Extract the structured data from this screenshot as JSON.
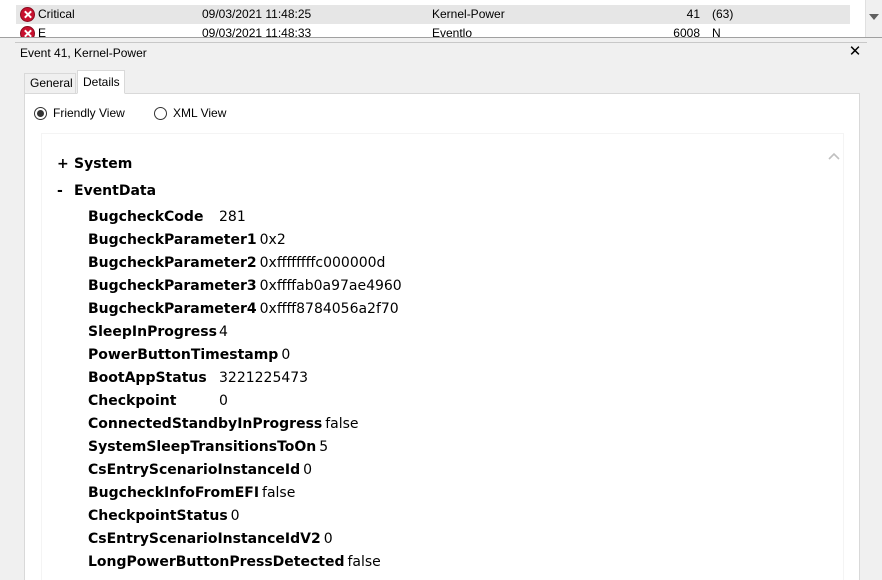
{
  "event_list": {
    "rows": [
      {
        "level": "Critical",
        "date": "09/03/2021 11:48:25",
        "source": "Kernel-Power",
        "event_id": "41",
        "task": "(63)",
        "selected": true
      },
      {
        "level": "E",
        "date": "09/03/2021 11:48:33",
        "source": "Eventlo",
        "event_id": "6008",
        "task": "N",
        "selected": false
      }
    ]
  },
  "detail": {
    "title": "Event 41, Kernel-Power",
    "close_glyph": "✕"
  },
  "tabs": [
    {
      "label": "General",
      "active": false
    },
    {
      "label": "Details",
      "active": true
    }
  ],
  "view_options": {
    "friendly_label": "Friendly View",
    "xml_label": "XML View",
    "selected": "friendly"
  },
  "tree": {
    "system": {
      "toggle": "+",
      "label": "System"
    },
    "eventdata": {
      "toggle": "-",
      "label": "EventData"
    }
  },
  "event_data": [
    {
      "name": "BugcheckCode",
      "value": "281",
      "aligned": true
    },
    {
      "name": "BugcheckParameter1",
      "value": "0x2",
      "aligned": false
    },
    {
      "name": "BugcheckParameter2",
      "value": "0xffffffffc000000d",
      "aligned": false
    },
    {
      "name": "BugcheckParameter3",
      "value": "0xffffab0a97ae4960",
      "aligned": false
    },
    {
      "name": "BugcheckParameter4",
      "value": "0xffff8784056a2f70",
      "aligned": false
    },
    {
      "name": "SleepInProgress",
      "value": "4",
      "aligned": true
    },
    {
      "name": "PowerButtonTimestamp",
      "value": "0",
      "aligned": false
    },
    {
      "name": "BootAppStatus",
      "value": "3221225473",
      "aligned": true
    },
    {
      "name": "Checkpoint",
      "value": "0",
      "aligned": true
    },
    {
      "name": "ConnectedStandbyInProgress",
      "value": "false",
      "aligned": false
    },
    {
      "name": "SystemSleepTransitionsToOn",
      "value": "5",
      "aligned": false
    },
    {
      "name": "CsEntryScenarioInstanceId",
      "value": "0",
      "aligned": false
    },
    {
      "name": "BugcheckInfoFromEFI",
      "value": "false",
      "aligned": false
    },
    {
      "name": "CheckpointStatus",
      "value": "0",
      "aligned": false
    },
    {
      "name": "CsEntryScenarioInstanceIdV2",
      "value": "0",
      "aligned": false
    },
    {
      "name": "LongPowerButtonPressDetected",
      "value": "false",
      "aligned": false
    }
  ]
}
